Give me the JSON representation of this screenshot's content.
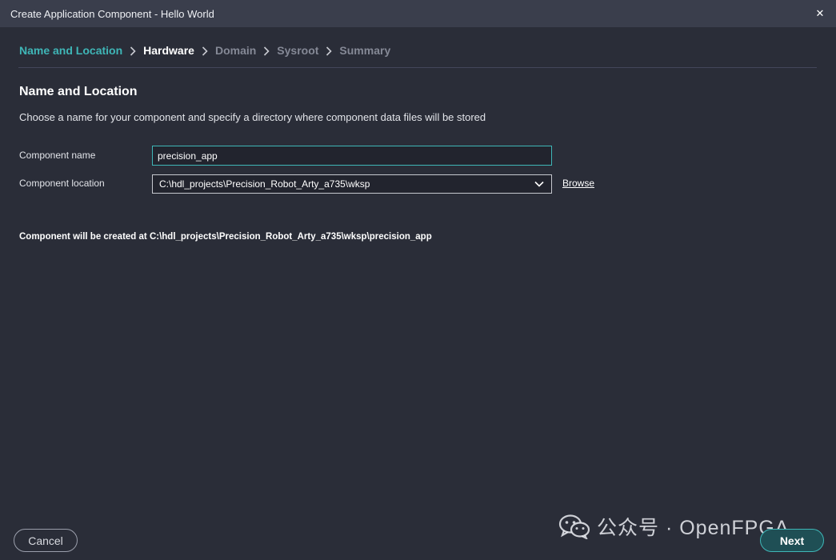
{
  "window": {
    "title": "Create Application Component - Hello World",
    "close_glyph": "✕"
  },
  "steps": [
    {
      "label": "Name and Location",
      "state": "active"
    },
    {
      "label": "Hardware",
      "state": "current"
    },
    {
      "label": "Domain",
      "state": "future"
    },
    {
      "label": "Sysroot",
      "state": "future"
    },
    {
      "label": "Summary",
      "state": "future"
    }
  ],
  "section": {
    "heading": "Name and Location",
    "description": "Choose a name for your component and specify a directory where component data files will be stored"
  },
  "form": {
    "name_label": "Component name",
    "name_value": "precision_app",
    "location_label": "Component location",
    "location_value": "C:\\hdl_projects\\Precision_Robot_Arty_a735\\wksp",
    "browse_label": "Browse"
  },
  "created_at": "Component will be created at C:\\hdl_projects\\Precision_Robot_Arty_a735\\wksp\\precision_app",
  "footer": {
    "cancel_label": "Cancel",
    "next_label": "Next"
  },
  "watermark": {
    "text": "公众号 · OpenFPGA",
    "icon": "wechat-icon"
  },
  "colors": {
    "accent": "#3fb6b7",
    "background": "#2a2d38",
    "titlebar": "#3a3e4c"
  }
}
